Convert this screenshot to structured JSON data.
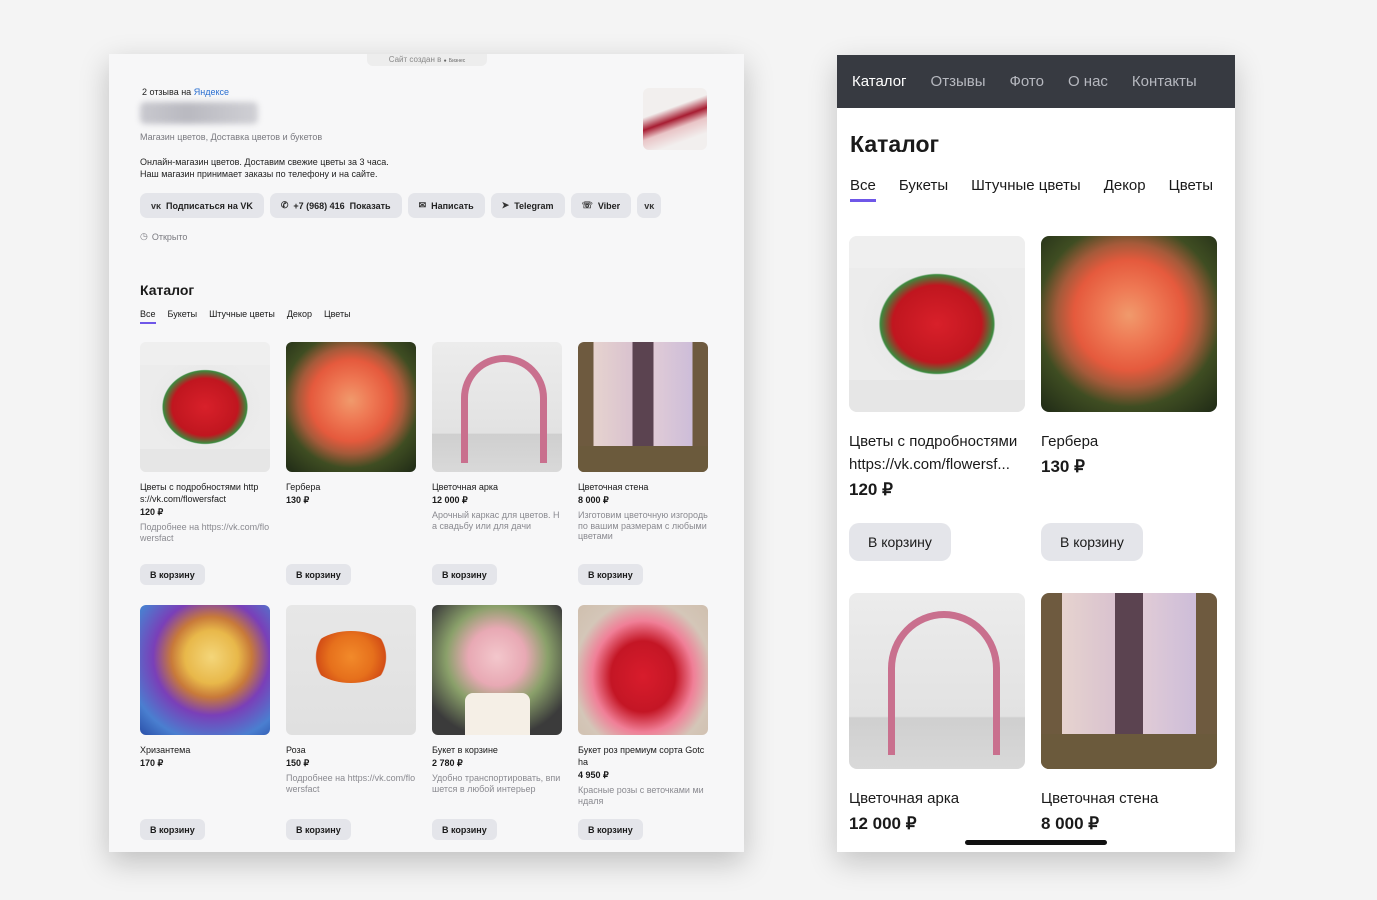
{
  "desktop": {
    "created_label": "Сайт создан в",
    "created_brand": "Бизнес",
    "reviews_text": "2 отзыва на",
    "reviews_link": "Яндексе",
    "subtitle": "Магазин цветов, Доставка цветов и букетов",
    "description_line1": "Онлайн-магазин цветов. Доставим свежие цветы за 3 часа.",
    "description_line2": "Наш магазин принимает заказы по телефону и на сайте.",
    "buttons": {
      "vk_subscribe": "Подписаться на VK",
      "phone": "+7 (968) 416",
      "phone_show": "Показать",
      "write": "Написать",
      "telegram": "Telegram",
      "viber": "Viber"
    },
    "status": "Открыто",
    "catalog_title": "Каталог",
    "tabs": [
      "Все",
      "Букеты",
      "Штучные цветы",
      "Декор",
      "Цветы"
    ],
    "cart_label": "В корзину",
    "products": [
      {
        "title": "Цветы с подробностями https://vk.com/flowersfact",
        "price": "120 ₽",
        "desc": "Подробнее на https://vk.com/flowersfact"
      },
      {
        "title": "Гербера",
        "price": "130 ₽",
        "desc": ""
      },
      {
        "title": "Цветочная арка",
        "price": "12 000 ₽",
        "desc": "Арочный каркас для цветов. На свадьбу или для дачи"
      },
      {
        "title": "Цветочная стена",
        "price": "8 000 ₽",
        "desc": "Изготовим цветочную изгородь по вашим размерам с любыми цветами"
      },
      {
        "title": "Хризантема",
        "price": "170 ₽",
        "desc": ""
      },
      {
        "title": "Роза",
        "price": "150 ₽",
        "desc": "Подробнее на https://vk.com/flowersfact"
      },
      {
        "title": "Букет в корзине",
        "price": "2 780 ₽",
        "desc": "Удобно транспортировать, впишется в любой интерьер"
      },
      {
        "title": "Букет роз премиум сорта Gotcha",
        "price": "4 950 ₽",
        "desc": "Красные розы с веточками миндаля"
      }
    ]
  },
  "mobile": {
    "nav": [
      "Каталог",
      "Отзывы",
      "Фото",
      "О нас",
      "Контакты"
    ],
    "catalog_title": "Каталог",
    "tabs": [
      "Все",
      "Букеты",
      "Штучные цветы",
      "Декор",
      "Цветы"
    ],
    "cart_label": "В корзину",
    "products": [
      {
        "title1": "Цветы с подробностями",
        "title2": "https://vk.com/flowersf...",
        "price": "120 ₽"
      },
      {
        "title1": "Гербера",
        "price": "130 ₽"
      },
      {
        "title1": "Цветочная арка",
        "price": "12 000 ₽"
      },
      {
        "title1": "Цветочная стена",
        "price": "8 000 ₽"
      }
    ]
  },
  "colors": {
    "accent": "#6f57e8",
    "link": "#2a6fd0",
    "nav_bg": "#373a41",
    "button_bg": "#e4e5ea"
  }
}
